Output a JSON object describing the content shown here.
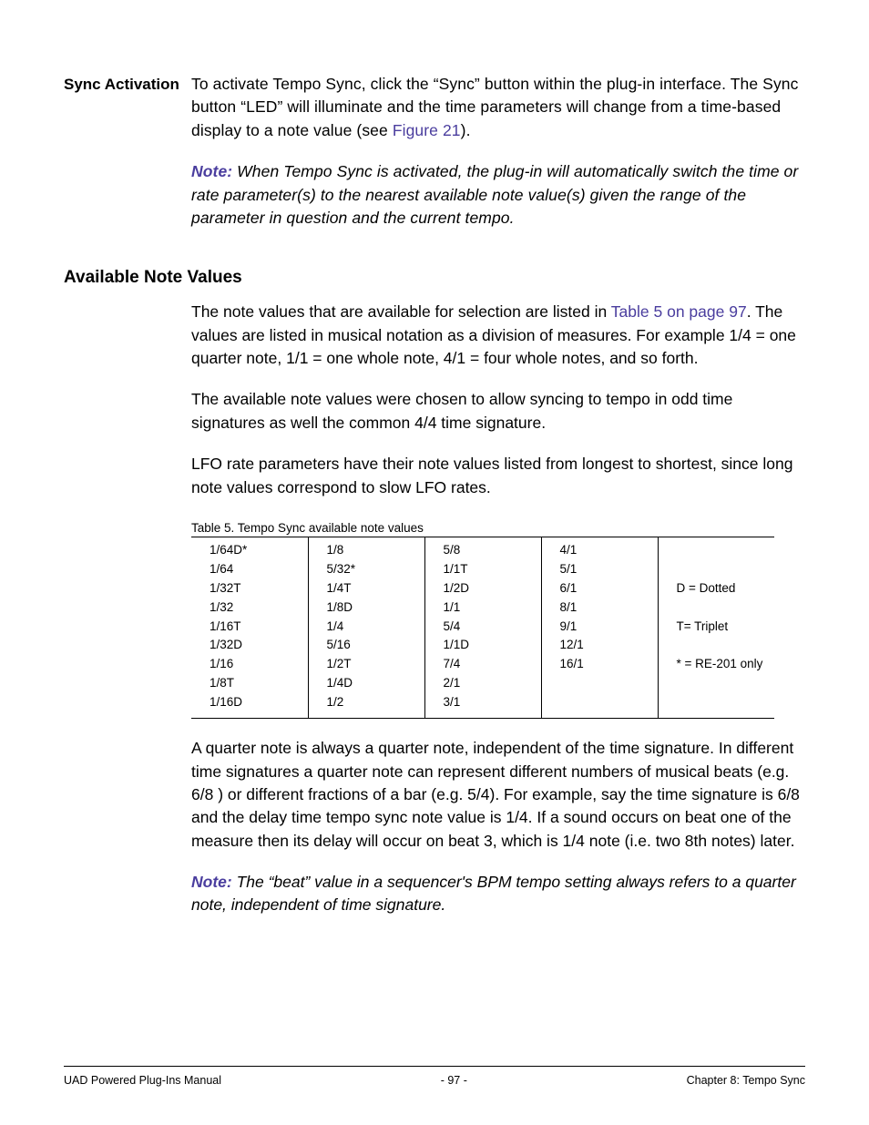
{
  "section1": {
    "heading": "Sync Activation",
    "p1_pre": "To activate Tempo Sync, click the “Sync” button within the plug-in interface. The Sync button “LED” will illuminate and the time parameters will change from a time-based display to a note value (see ",
    "p1_link": "Figure 21",
    "p1_post": ").",
    "note_label": "Note:",
    "note_text": " When Tempo Sync is activated, the plug-in will automatically switch the time or rate parameter(s) to the nearest available note value(s) given the range of the parameter in question and the current tempo."
  },
  "section2": {
    "heading": "Available Note Values",
    "p1_pre": "The note values that are available for selection are listed in ",
    "p1_link": "Table 5 on page 97",
    "p1_post": ". The values are listed in musical notation as a division of measures. For example 1/4 = one quarter note, 1/1 = one whole note, 4/1 = four whole notes, and so forth.",
    "p2": "The available note values were chosen to allow syncing to tempo in odd time signatures as well the common 4/4 time signature.",
    "p3": "LFO rate parameters have their note values listed from longest to shortest, since long note values correspond to slow LFO rates."
  },
  "table": {
    "caption": "Table 5. Tempo Sync available note values",
    "columns": [
      [
        "1/64D*",
        "1/64",
        "1/32T",
        "1/32",
        "1/16T",
        "1/32D",
        "1/16",
        "1/8T",
        "1/16D"
      ],
      [
        "1/8",
        "5/32*",
        "1/4T",
        "1/8D",
        "1/4",
        "5/16",
        "1/2T",
        "1/4D",
        "1/2"
      ],
      [
        "5/8",
        "1/1T",
        "1/2D",
        "1/1",
        "5/4",
        "1/1D",
        "7/4",
        "2/1",
        "3/1"
      ],
      [
        "4/1",
        "5/1",
        "6/1",
        "8/1",
        "9/1",
        "12/1",
        "16/1"
      ],
      [
        "",
        "",
        "D = Dotted",
        "",
        "T= Triplet",
        "",
        "* = RE-201 only"
      ]
    ]
  },
  "after_table": {
    "p1": "A quarter note is always a quarter note, independent of the time signature. In different time signatures a quarter note can represent different numbers of musical beats (e.g. 6/8 ) or different fractions of a bar (e.g. 5/4). For example, say the time signature is 6/8 and the delay time tempo sync note value is 1/4. If a sound occurs on beat one of the measure then its delay will occur on beat 3, which is 1/4 note (i.e. two 8th notes) later.",
    "note_label": "Note:",
    "note_text": " The “beat” value in a sequencer's BPM tempo setting always refers to a quarter note, independent of time signature."
  },
  "footer": {
    "left": "UAD Powered Plug-Ins Manual",
    "center": "- 97 -",
    "right": "Chapter 8: Tempo Sync"
  }
}
